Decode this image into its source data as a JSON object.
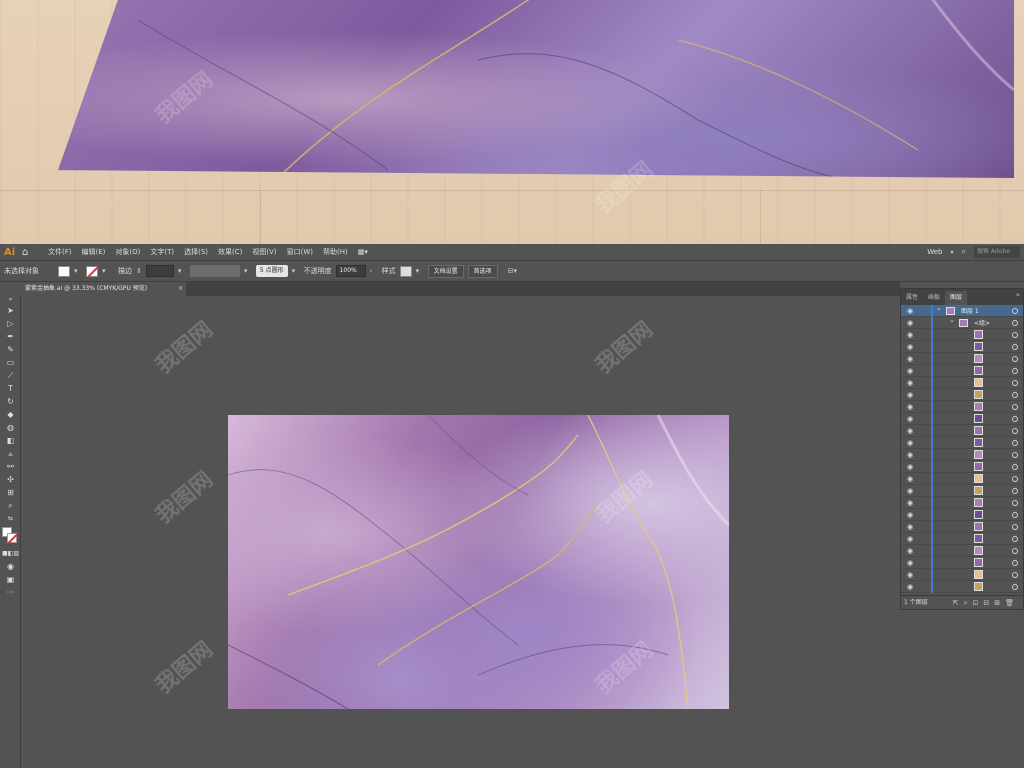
{
  "app": {
    "logo": "Ai",
    "menus": [
      "文件(F)",
      "编辑(E)",
      "对象(O)",
      "文字(T)",
      "选择(S)",
      "效果(C)",
      "视图(V)",
      "窗口(W)",
      "帮助(H)"
    ],
    "workspace": "Web",
    "search_placeholder": "搜索 Adobe"
  },
  "control_bar": {
    "selection_status": "未选择对象",
    "stroke_label": "描边",
    "brush_value": "5 点圆形",
    "opacity_label": "不透明度",
    "opacity_value": "100%",
    "style_label": "样式",
    "doc_setup_button": "文档设置",
    "preferences_button": "首选项"
  },
  "document": {
    "tab_title": "雾紫金抽象.ai @ 33.33% (CMYK/GPU 预览)",
    "close_glyph": "×"
  },
  "layers_panel": {
    "tabs": [
      "属性",
      "画板",
      "图层"
    ],
    "active_tab": "图层",
    "top_layer_name": "图层 1",
    "sublayer_name": "<组>",
    "item_count": 22,
    "footer_label": "1 个图层"
  },
  "watermark_text": "我图网",
  "icons": {
    "home": "home-icon",
    "eye": "eye-icon",
    "search": "search-icon"
  },
  "colors": {
    "ui_bg": "#535353",
    "panel_selection": "#46698f",
    "layer_color": "#3d7bd6",
    "ai_orange": "#e38b2d"
  }
}
